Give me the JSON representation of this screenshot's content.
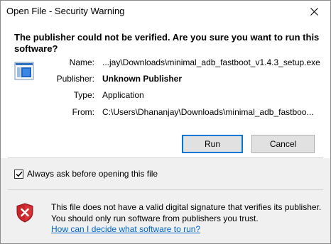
{
  "window": {
    "title": "Open File - Security Warning"
  },
  "warning": {
    "headline": "The publisher could not be verified.  Are you sure you want to run this software?"
  },
  "details": {
    "name_label": "Name:",
    "name_value": "...jay\\Downloads\\minimal_adb_fastboot_v1.4.3_setup.exe",
    "publisher_label": "Publisher:",
    "publisher_value": "Unknown Publisher",
    "type_label": "Type:",
    "type_value": "Application",
    "from_label": "From:",
    "from_value": "C:\\Users\\Dhananjay\\Downloads\\minimal_adb_fastboo..."
  },
  "buttons": {
    "run": "Run",
    "cancel": "Cancel"
  },
  "checkbox": {
    "label": "Always ask before opening this file",
    "checked": true
  },
  "footer": {
    "message": "This file does not have a valid digital signature that verifies its publisher.  You should only run software from publishers you trust.",
    "link": "How can I decide what software to run?"
  },
  "colors": {
    "accent": "#0078d7",
    "link": "#0066cc",
    "shield_red": "#c8262b"
  }
}
